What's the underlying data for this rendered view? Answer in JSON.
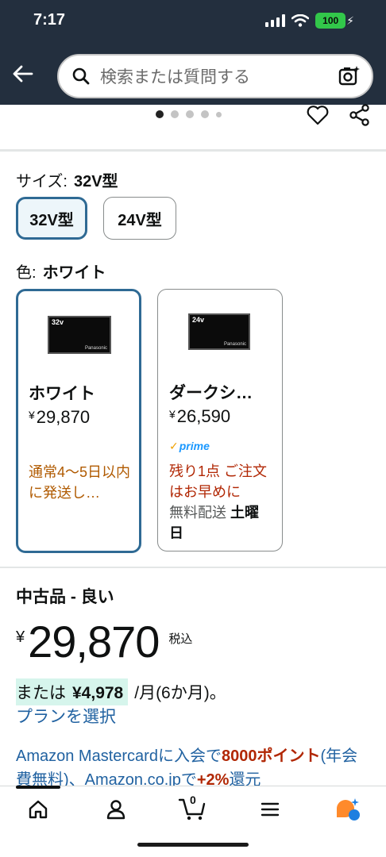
{
  "status_bar": {
    "time": "7:17",
    "battery": "100"
  },
  "search": {
    "placeholder": "検索または質問する"
  },
  "size_selector": {
    "label": "サイズ:",
    "selected": "32V型",
    "options": [
      "32V型",
      "24V型"
    ]
  },
  "color_selector": {
    "label": "色:",
    "selected": "ホワイト",
    "cards": [
      {
        "tv_label": "32v",
        "tv_brand": "Panasonic",
        "name": "ホワイト",
        "price": "29,870",
        "currency": "¥",
        "note": "通常4〜5日以内に発送し…"
      },
      {
        "tv_label": "24v",
        "tv_brand": "Panasonic",
        "name": "ダークシ…",
        "price": "26,590",
        "currency": "¥",
        "prime": "prime",
        "stock_note": "残り1点 ご注文はお早めに",
        "shipping_prefix": "無料配送",
        "shipping_day": "土曜日"
      }
    ]
  },
  "offer": {
    "condition": "中古品 - 良い",
    "currency": "¥",
    "price": "29,870",
    "tax_note": "税込",
    "installment_prefix": "または",
    "installment_amount": "¥4,978",
    "installment_suffix": "/月(6か月)。",
    "plan_link": "プランを選択"
  },
  "promo": {
    "part1": "Amazon Mastercardに入会で",
    "points": "8000ポイント",
    "part2": "(年会費無料)、Amazon.co.jpで",
    "percent": "+2%",
    "part3": "還元"
  },
  "bottom_nav": {
    "items": [
      "home-icon",
      "account-icon",
      "cart-icon",
      "menu-icon",
      "rufus-icon"
    ],
    "cart_count": "0"
  },
  "colors": {
    "header_bg": "#232f3e",
    "selected_border": "#2f6a94",
    "link": "#2162a1",
    "deal_red": "#b12704",
    "ship_orange": "#b05a00"
  }
}
